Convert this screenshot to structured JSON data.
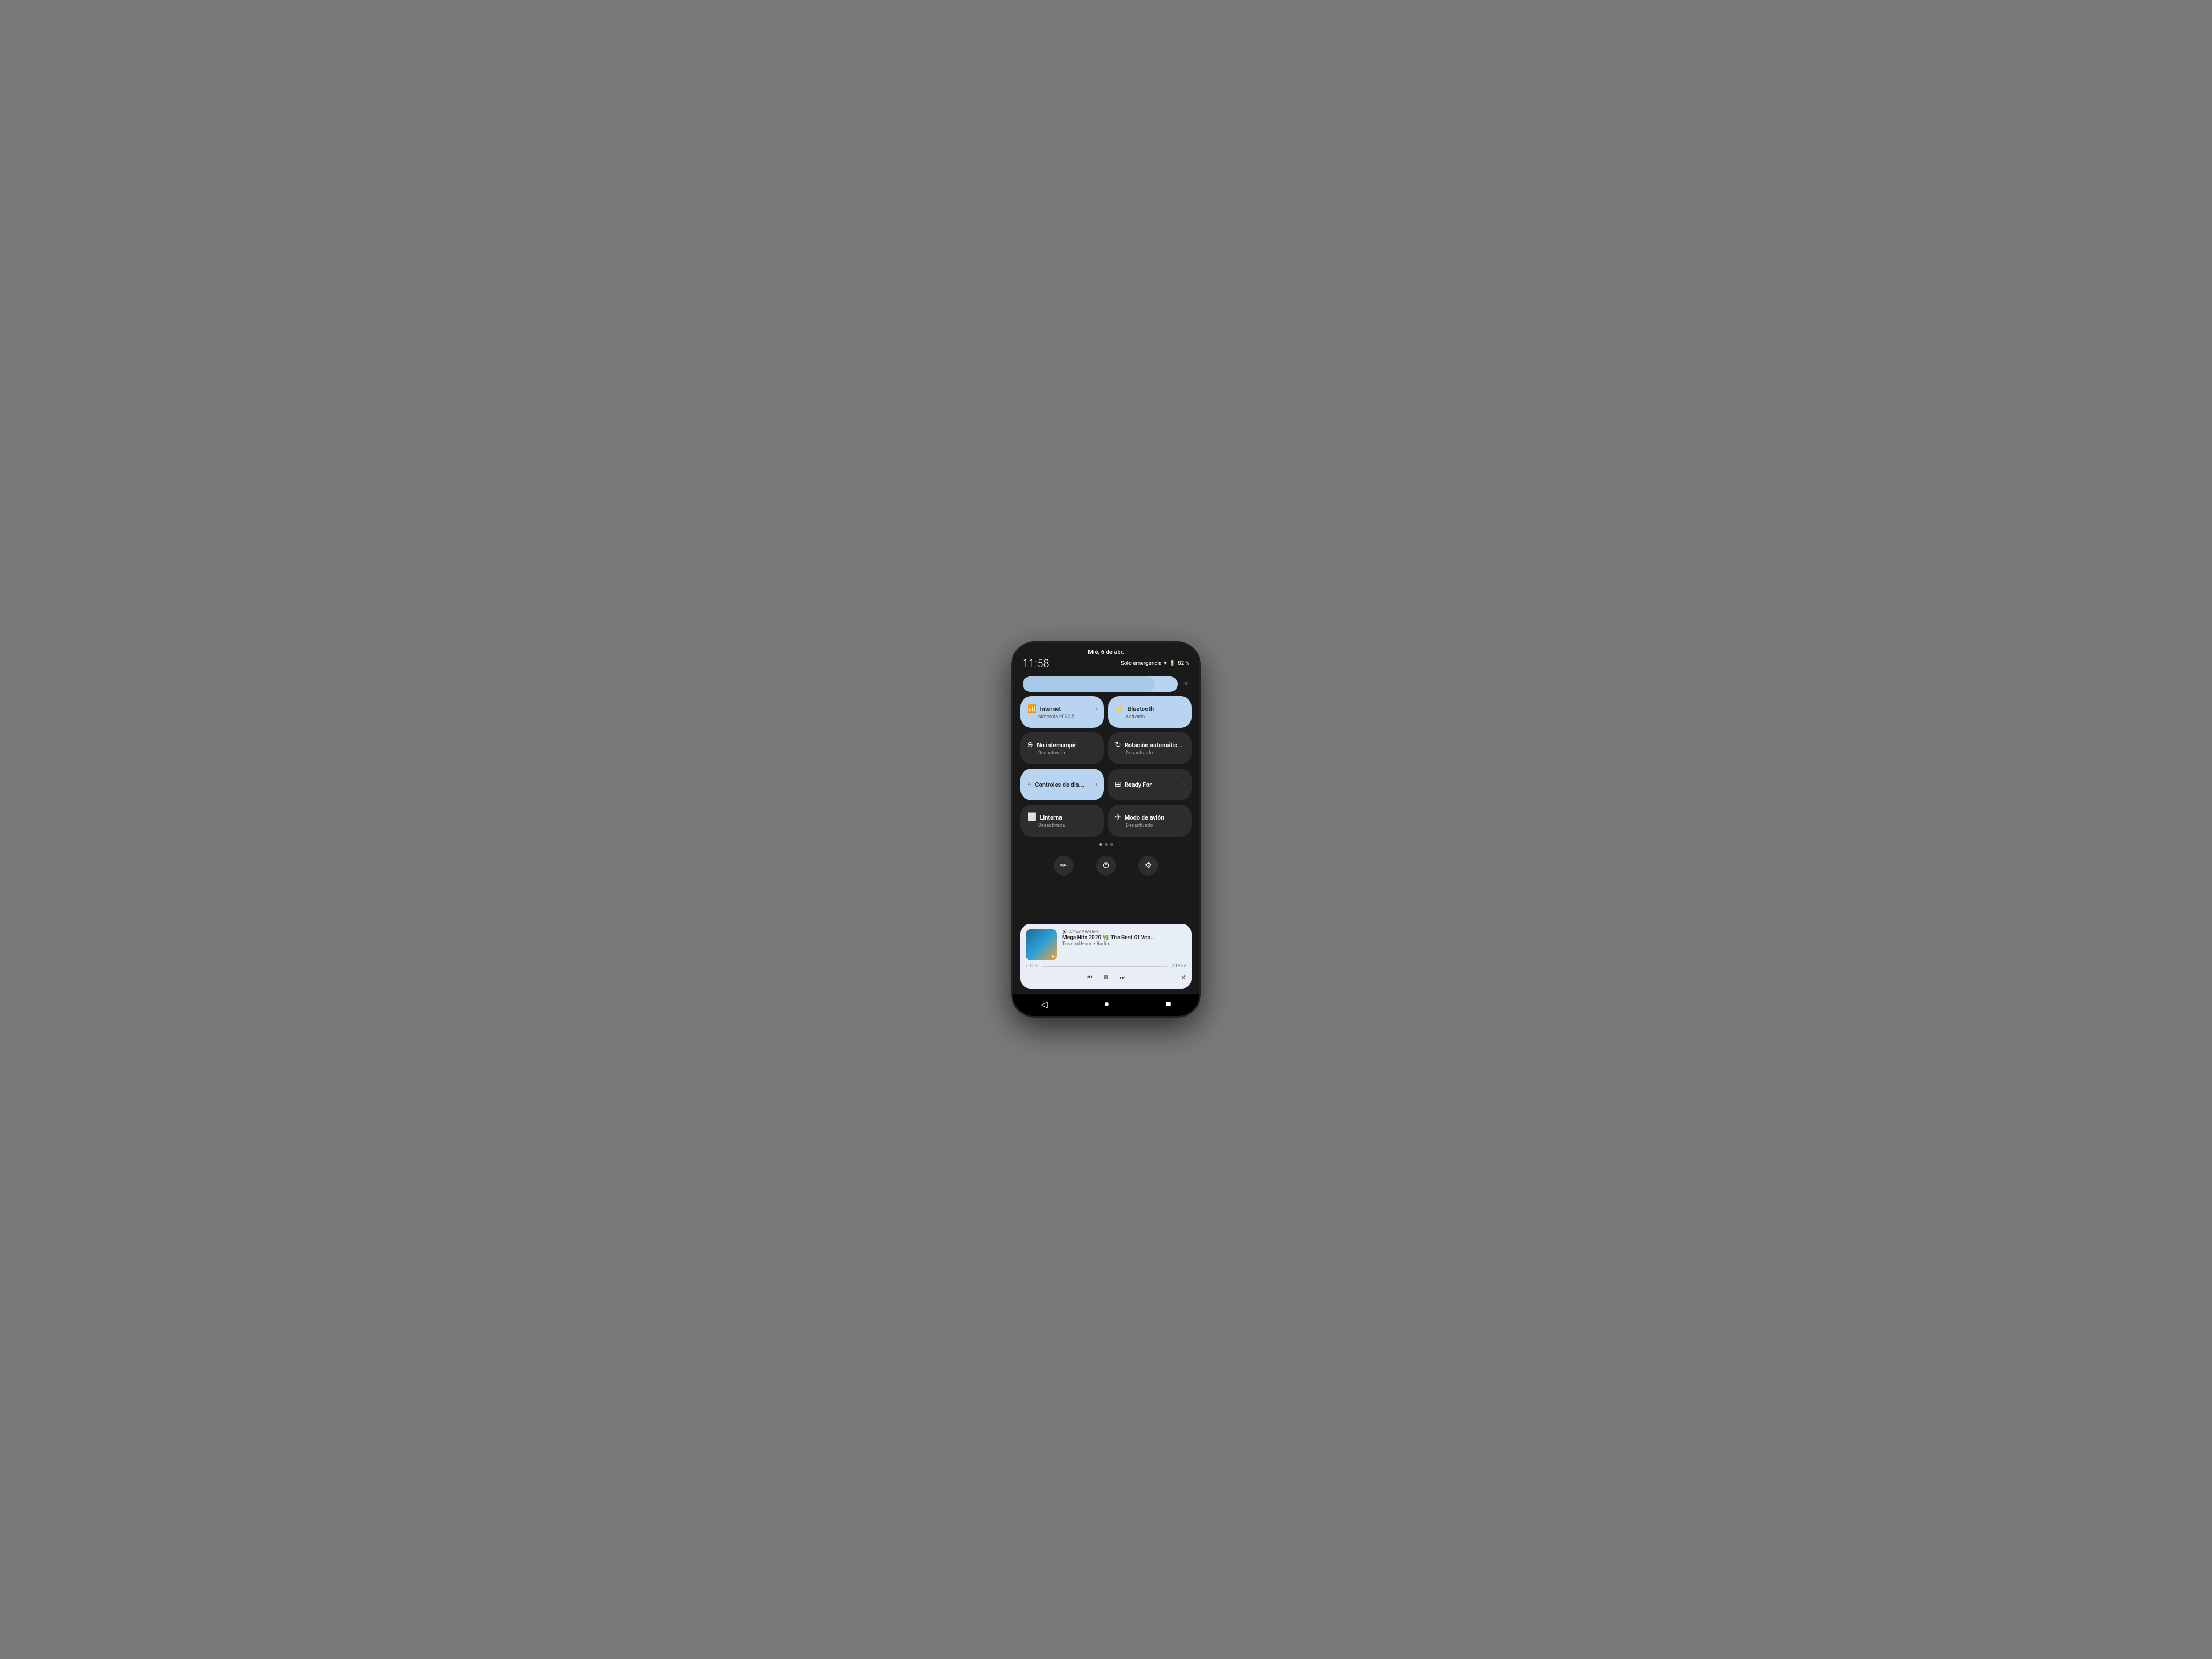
{
  "statusBar": {
    "date": "Mié, 6 de abr.",
    "time": "11:58",
    "emergency": "Solo emergencia",
    "wifi_icon": "📶",
    "battery": "82 %"
  },
  "brightness": {
    "fill_percent": 85
  },
  "toggles": [
    {
      "id": "internet",
      "icon": "📶",
      "label": "Internet",
      "sublabel": "Motorola 2022 5...",
      "active": true,
      "has_chevron": true
    },
    {
      "id": "bluetooth",
      "icon": "✱",
      "label": "Bluetooth",
      "sublabel": "Activado",
      "active": true,
      "has_chevron": false
    },
    {
      "id": "no-interrumpir",
      "icon": "⊖",
      "label": "No interrumpir",
      "sublabel": "Desactivado",
      "active": false,
      "has_chevron": false
    },
    {
      "id": "rotacion",
      "icon": "⟳",
      "label": "Rotación automátic...",
      "sublabel": "Desactivada",
      "active": false,
      "has_chevron": false
    },
    {
      "id": "controles",
      "icon": "⌂",
      "label": "Controles de dis...",
      "sublabel": "",
      "active": true,
      "has_chevron": true
    },
    {
      "id": "readyfor",
      "icon": "⊞",
      "label": "Ready For",
      "sublabel": "",
      "active": false,
      "has_chevron": true
    },
    {
      "id": "linterna",
      "icon": "🔦",
      "label": "Linterna",
      "sublabel": "Desactivada",
      "active": false,
      "has_chevron": false
    },
    {
      "id": "avion",
      "icon": "✈",
      "label": "Modo de avión",
      "sublabel": "Desactivado",
      "active": false,
      "has_chevron": false
    }
  ],
  "pageDots": [
    {
      "active": true
    },
    {
      "active": false
    },
    {
      "active": false
    }
  ],
  "shortcuts": [
    {
      "icon": "✏",
      "label": "edit"
    },
    {
      "icon": "⏻",
      "label": "power"
    },
    {
      "icon": "⚙",
      "label": "settings"
    }
  ],
  "mediaPlayer": {
    "source": "Altavoz del telé...",
    "title": "Mega Hits 2020 🌿 The Best Of Voc...",
    "artist": "Tropical House Radio",
    "time_elapsed": "00:00",
    "time_total": "2:16:37",
    "progress": 0
  },
  "navBar": {
    "back": "◁",
    "home": "●",
    "recents": "■"
  }
}
